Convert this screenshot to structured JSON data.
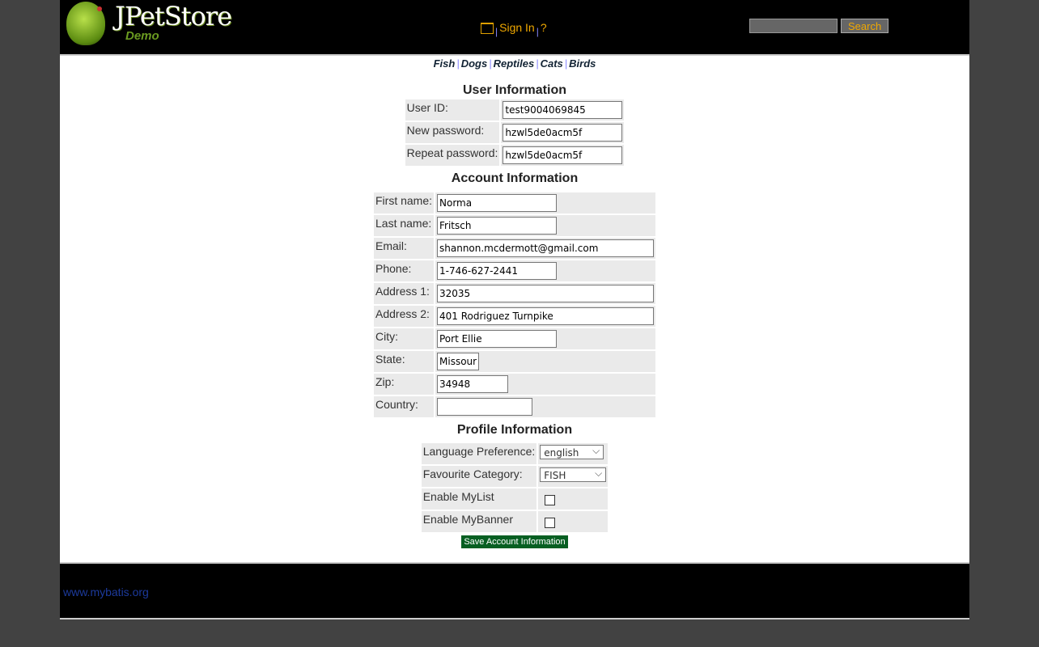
{
  "header": {
    "logo_title": "JPetStore",
    "logo_subtitle": "Demo",
    "sign_in": "Sign In",
    "help": "?",
    "search_placeholder": "",
    "search_button": "Search"
  },
  "quicklinks": [
    "Fish",
    "Dogs",
    "Reptiles",
    "Cats",
    "Birds"
  ],
  "user_info": {
    "heading": "User Information",
    "fields": [
      {
        "label": "User ID:",
        "value": "test9004069845"
      },
      {
        "label": "New password:",
        "value": "hzwl5de0acm5f"
      },
      {
        "label": "Repeat password:",
        "value": "hzwl5de0acm5f"
      }
    ]
  },
  "account_info": {
    "heading": "Account Information",
    "fields": [
      {
        "label": "First name:",
        "value": "Norma"
      },
      {
        "label": "Last name:",
        "value": "Fritsch"
      },
      {
        "label": "Email:",
        "value": "shannon.mcdermott@gmail.com"
      },
      {
        "label": "Phone:",
        "value": "1-746-627-2441"
      },
      {
        "label": "Address 1:",
        "value": "32035"
      },
      {
        "label": "Address 2:",
        "value": "401 Rodriguez Turnpike"
      },
      {
        "label": "City:",
        "value": "Port Ellie"
      },
      {
        "label": "State:",
        "value": "Missouri"
      },
      {
        "label": "Zip:",
        "value": "34948"
      },
      {
        "label": "Country:",
        "value": ""
      }
    ]
  },
  "profile_info": {
    "heading": "Profile Information",
    "language_label": "Language Preference:",
    "language_value": "english",
    "category_label": "Favourite Category:",
    "category_value": "FISH",
    "mylist_label": "Enable MyList",
    "mybanner_label": "Enable MyBanner"
  },
  "save_button": "Save Account Information",
  "footer": {
    "link": "www.mybatis.org"
  }
}
